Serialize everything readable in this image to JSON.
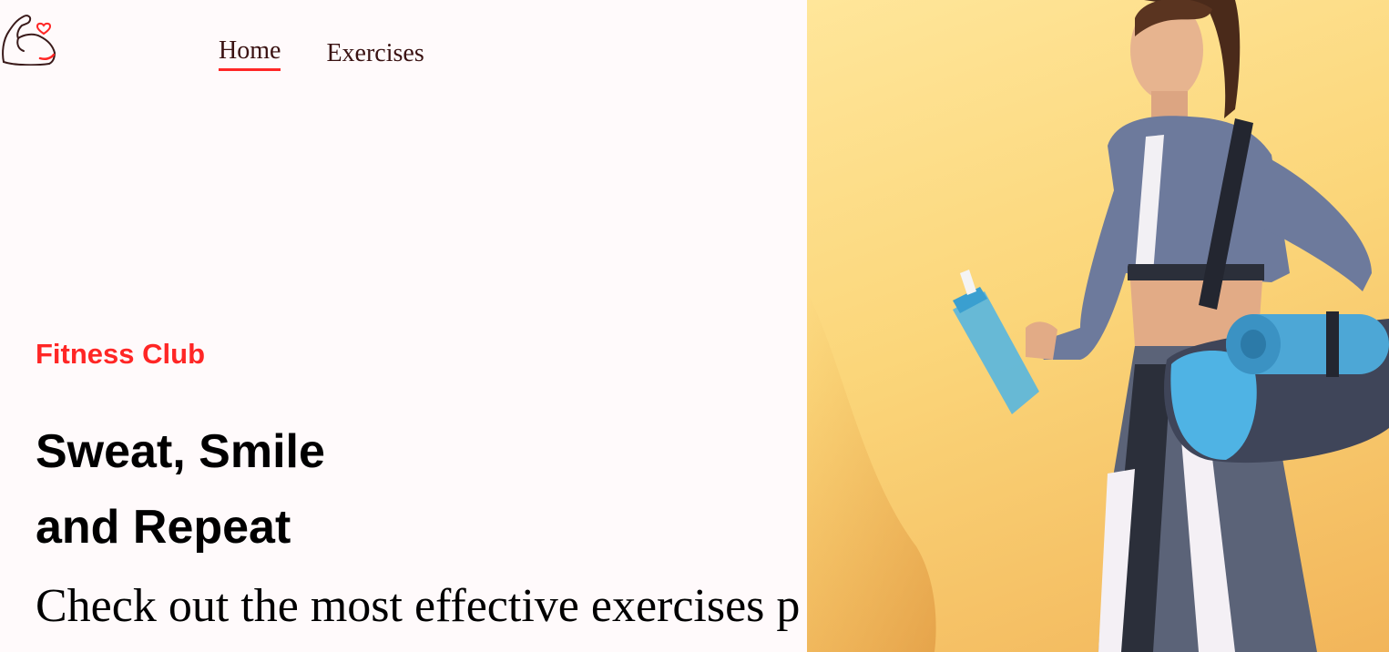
{
  "nav": {
    "home_label": "Home",
    "exercises_label": "Exercises"
  },
  "hero": {
    "tagline": "Fitness Club",
    "headline_line1": "Sweat, Smile",
    "headline_line2": "and Repeat",
    "subtext": "Check out the most effective exercises p"
  },
  "colors": {
    "accent": "#ff2625",
    "background": "#fffafb",
    "image_background": "#fbd67a"
  },
  "icons": {
    "logo": "flexed-arm-heart-icon"
  }
}
